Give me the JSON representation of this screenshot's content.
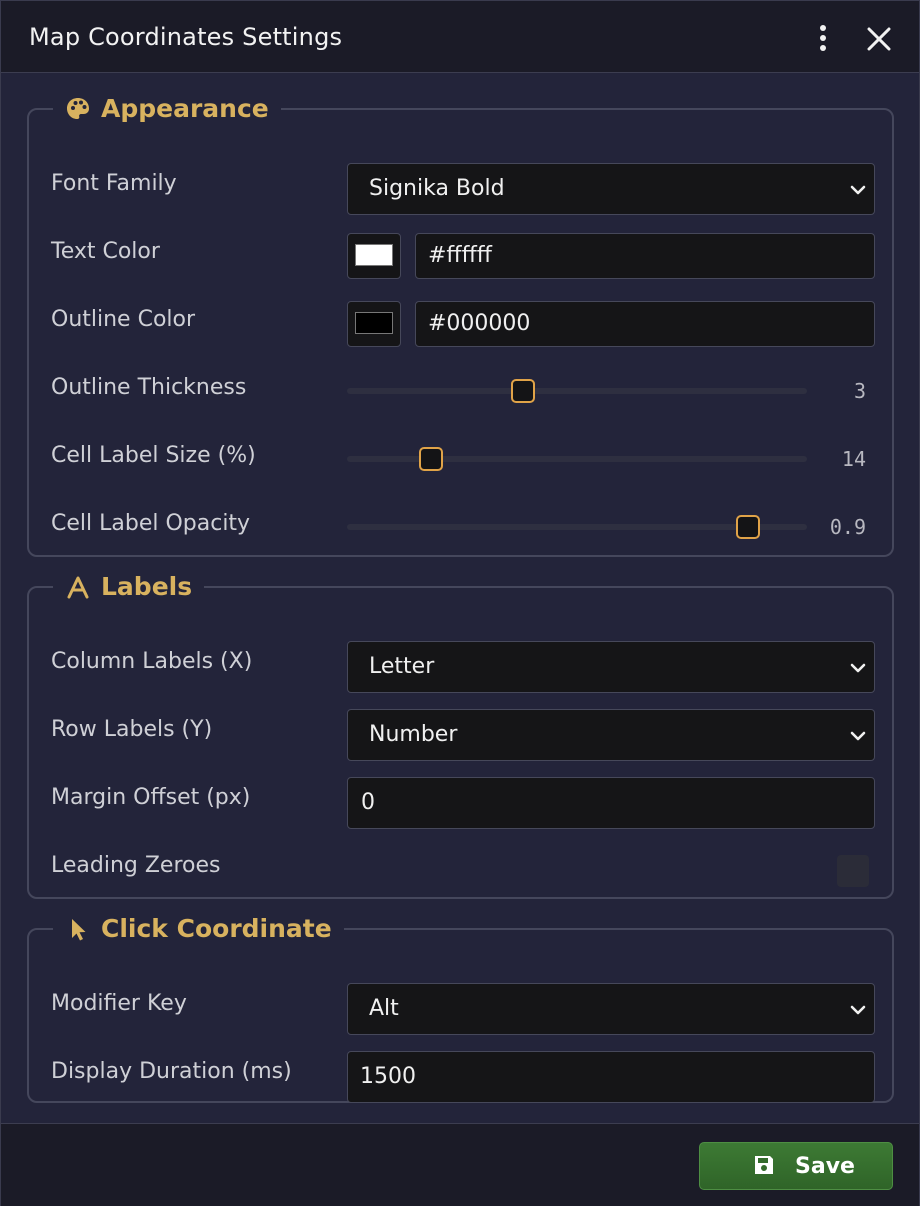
{
  "window": {
    "title": "Map Coordinates Settings"
  },
  "icons": {
    "menu": "vertical-ellipsis-icon",
    "close": "close-icon",
    "appearance": "palette-icon",
    "labels": "letter-a-icon",
    "click": "cursor-pointer-icon",
    "chevron": "chevron-down-icon",
    "save": "floppy-disk-icon"
  },
  "colors": {
    "accent": "#d8b25f",
    "slider_thumb_border": "#e0a348",
    "save_button": "#3a7531"
  },
  "appearance": {
    "legend": "Appearance",
    "font_family": {
      "label": "Font Family",
      "value": "Signika Bold"
    },
    "text_color": {
      "label": "Text Color",
      "value": "#ffffff"
    },
    "outline_color": {
      "label": "Outline Color",
      "value": "#000000"
    },
    "outline_thickness": {
      "label": "Outline Thickness",
      "value": "3",
      "fraction": 0.38
    },
    "cell_label_size": {
      "label": "Cell Label Size (%)",
      "value": "14",
      "fraction": 0.18
    },
    "cell_label_opacity": {
      "label": "Cell Label Opacity",
      "value": "0.9",
      "fraction": 0.87
    }
  },
  "labels": {
    "legend": "Labels",
    "column_labels": {
      "label": "Column Labels (X)",
      "value": "Letter"
    },
    "row_labels": {
      "label": "Row Labels (Y)",
      "value": "Number"
    },
    "margin_offset": {
      "label": "Margin Offset (px)",
      "value": "0"
    },
    "leading_zeroes": {
      "label": "Leading Zeroes",
      "checked": false
    }
  },
  "click_coordinate": {
    "legend": "Click Coordinate",
    "modifier_key": {
      "label": "Modifier Key",
      "value": "Alt"
    },
    "display_duration": {
      "label": "Display Duration (ms)",
      "value": "1500"
    }
  },
  "footer": {
    "save_label": "Save"
  }
}
